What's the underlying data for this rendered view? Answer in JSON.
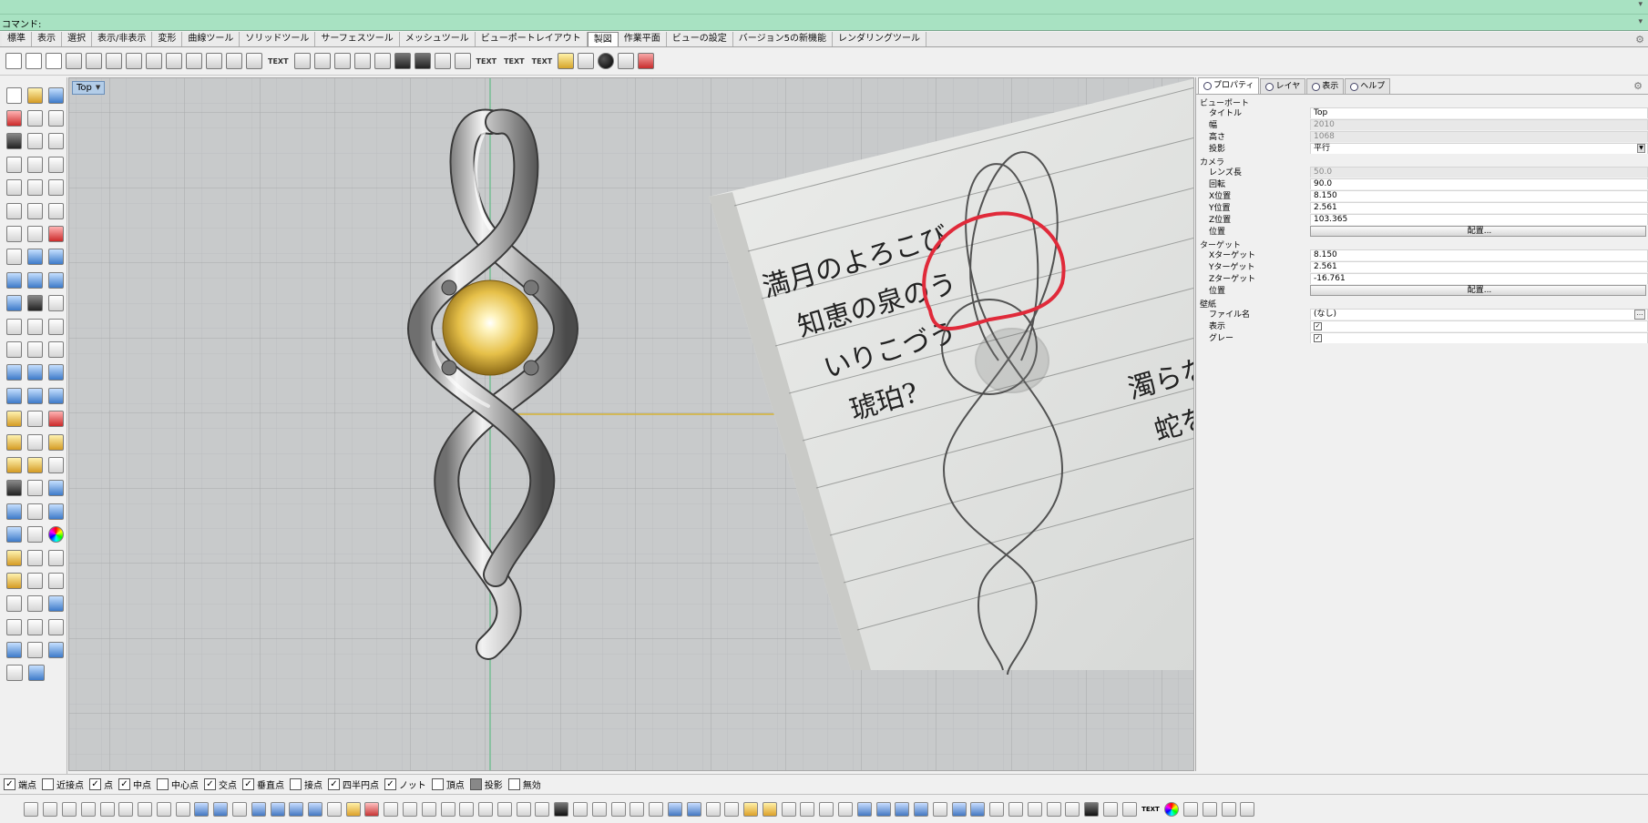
{
  "command": {
    "label": "コマンド:"
  },
  "tabs": [
    "標準",
    "表示",
    "選択",
    "表示/非表示",
    "変形",
    "曲線ツール",
    "ソリッドツール",
    "サーフェスツール",
    "メッシュツール",
    "ビューポートレイアウト",
    "製図",
    "作業平面",
    "ビューの設定",
    "バージョン5の新機能",
    "レンダリングツール"
  ],
  "active_tab_index": 10,
  "toolbar_text": {
    "t1": "TEXT",
    "t2": "TEXT",
    "t3": "TEXT",
    "t4": "TEXT"
  },
  "viewport": {
    "title": "Top"
  },
  "panel": {
    "tabs": [
      "プロパティ",
      "レイヤ",
      "表示",
      "ヘルプ"
    ],
    "sections": {
      "viewport": "ビューポート",
      "camera": "カメラ",
      "target": "ターゲット",
      "wallpaper": "壁紙"
    },
    "props": {
      "title": {
        "label": "タイトル",
        "value": "Top"
      },
      "width": {
        "label": "幅",
        "value": "2010"
      },
      "height": {
        "label": "高さ",
        "value": "1068"
      },
      "projection": {
        "label": "投影",
        "value": "平行"
      },
      "lens": {
        "label": "レンズ長",
        "value": "50.0"
      },
      "rotation": {
        "label": "回転",
        "value": "90.0"
      },
      "xpos": {
        "label": "X位置",
        "value": "8.150"
      },
      "ypos": {
        "label": "Y位置",
        "value": "2.561"
      },
      "zpos": {
        "label": "Z位置",
        "value": "103.365"
      },
      "pos": {
        "label": "位置",
        "button": "配置..."
      },
      "xtarget": {
        "label": "Xターゲット",
        "value": "8.150"
      },
      "ytarget": {
        "label": "Yターゲット",
        "value": "2.561"
      },
      "ztarget": {
        "label": "Zターゲット",
        "value": "-16.761"
      },
      "tpos": {
        "label": "位置",
        "button": "配置..."
      },
      "filename": {
        "label": "ファイル名",
        "value": "(なし)"
      },
      "show": {
        "label": "表示"
      },
      "gray": {
        "label": "グレー"
      }
    }
  },
  "osnaps": [
    {
      "label": "端点",
      "checked": true
    },
    {
      "label": "近接点",
      "checked": false
    },
    {
      "label": "点",
      "checked": true
    },
    {
      "label": "中点",
      "checked": true
    },
    {
      "label": "中心点",
      "checked": false
    },
    {
      "label": "交点",
      "checked": true
    },
    {
      "label": "垂直点",
      "checked": true
    },
    {
      "label": "接点",
      "checked": false
    },
    {
      "label": "四半円点",
      "checked": true
    },
    {
      "label": "ノット",
      "checked": true
    },
    {
      "label": "頂点",
      "checked": false
    },
    {
      "label": "投影",
      "checked": false
    },
    {
      "label": "無効",
      "checked": false
    }
  ],
  "bottom_text": {
    "t1": "TEXT"
  },
  "colors": {
    "gem": "#e8c24a",
    "metal": "#b5b5b5",
    "sketch_red": "#e02a3a",
    "grid_bg": "#c8cacb"
  },
  "notebook_text": {
    "line1": "満月のよろこび",
    "line2": "知恵の泉のう",
    "line3": "いりこづう",
    "line4": "琥珀?",
    "line5": "濁らながら",
    "line6": "蛇を思わ"
  }
}
